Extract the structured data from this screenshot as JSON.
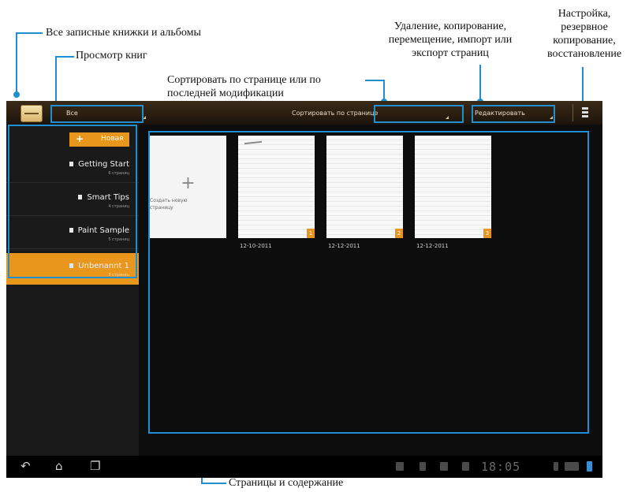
{
  "annotations": {
    "all_notebooks": "Все записные книжки и альбомы",
    "book_view": "Просмотр книг",
    "sort": [
      "Сортировать по странице или по",
      "последней модификации"
    ],
    "edit_pages": [
      "Удаление, копирование,",
      "перемещение, импорт или",
      "экспорт страниц"
    ],
    "settings": [
      "Настройка,",
      "резервное",
      "копирование,",
      "восстановление"
    ],
    "pages_content": "Страницы и содержание"
  },
  "topbar": {
    "view_filter": "Все",
    "sort_by": "Сортировать по странице",
    "edit": "Редактировать"
  },
  "sidebar": {
    "new_button": "Новая",
    "notebooks": [
      {
        "title": "Getting Start",
        "subtitle": "6 страниц"
      },
      {
        "title": "Smart Tips",
        "subtitle": "4 страниц"
      },
      {
        "title": "Paint Sample",
        "subtitle": "5 страниц"
      },
      {
        "title": "Unbenannt 1",
        "subtitle": "3 страниц",
        "selected": true
      }
    ]
  },
  "pages": {
    "new_page_label": [
      "Создать новую",
      "страницу"
    ],
    "items": [
      {
        "date": "12-10-2011",
        "number": "1"
      },
      {
        "date": "12-12-2011",
        "number": "2"
      },
      {
        "date": "12-12-2011",
        "number": "3"
      }
    ]
  },
  "system_bar": {
    "clock": "18:05"
  },
  "colors": {
    "accent": "#e9961d",
    "callout_blue": "#1f8fd1",
    "screen_bg": "#141414"
  },
  "icons": [
    "back-icon",
    "home-icon",
    "recent-apps-icon",
    "settings-icon",
    "notebook-app-icon"
  ]
}
